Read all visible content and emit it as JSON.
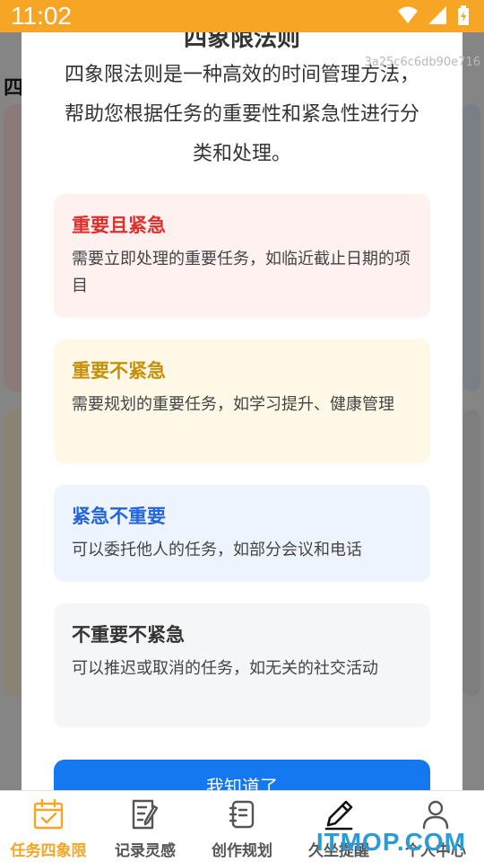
{
  "status_bar": {
    "time": "11:02",
    "bg_color": "#f6a524"
  },
  "background": {
    "heading": "四"
  },
  "modal": {
    "title": "四象限法则",
    "description": "四象限法则是一种高效的时间管理方法，帮助您根据任务的重要性和紧急性进行分类和处理。",
    "quadrants": [
      {
        "title": "重要且紧急",
        "desc": "需要立即处理的重要任务，如临近截止日期的项目",
        "color": "#e02f2c"
      },
      {
        "title": "重要不紧急",
        "desc": "需要规划的重要任务，如学习提升、健康管理",
        "color": "#c7900a"
      },
      {
        "title": "紧急不重要",
        "desc": "可以委托他人的任务，如部分会议和电话",
        "color": "#2466d9"
      },
      {
        "title": "不重要不紧急",
        "desc": "可以推迟或取消的任务，如无关的社交活动",
        "color": "#333333"
      }
    ],
    "confirm_label": "我知道了",
    "confirm_color": "#1478f0"
  },
  "hash_text": "3a25c6c6db90e716",
  "bottom_nav": {
    "items": [
      {
        "label": "任务四象限",
        "icon": "calendar-check-icon",
        "active": true
      },
      {
        "label": "记录灵感",
        "icon": "note-pen-icon",
        "active": false
      },
      {
        "label": "创作规划",
        "icon": "notebook-icon",
        "active": false
      },
      {
        "label": "久坐提醒",
        "icon": "pencil-icon",
        "active": false
      },
      {
        "label": "个人中心",
        "icon": "user-icon",
        "active": false
      }
    ],
    "active_color": "#f6a524"
  },
  "watermark": "ITMOP.COM"
}
